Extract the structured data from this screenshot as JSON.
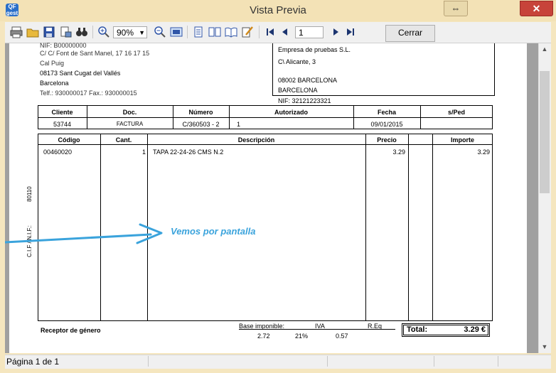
{
  "window": {
    "title": "Vista Previa",
    "app_icon_text": "QF\ngest",
    "restore_glyph": "⇔",
    "close_glyph": "✕"
  },
  "toolbar": {
    "zoom_value": "90%",
    "page_value": "1",
    "close_label": "Cerrar"
  },
  "status": {
    "page_text": "Página 1 de 1"
  },
  "sender": {
    "nif": "NIF: B00000000",
    "addr1": "C/ C/ Font de Sant Manel, 17 16 17 15",
    "addr2": "Cal Puig",
    "city": "08173 Sant Cugat del Vallés",
    "province": "Barcelona",
    "phones": "Telf.: 930000017 Fax.: 930000015"
  },
  "recipient": {
    "name": "Empresa de pruebas S.L.",
    "street": "C\\ Alicante, 3",
    "zip_city": "08002 BARCELONA",
    "province": "BARCELONA",
    "nif": "NIF: 32121223321"
  },
  "header_table": {
    "labels": {
      "cliente": "Cliente",
      "doc": "Doc.",
      "numero": "Número",
      "autorizado": "Autorizado",
      "fecha": "Fecha",
      "sped": "s/Ped"
    },
    "values": {
      "cliente": "53744",
      "doc": "FACTURA",
      "numero": "C/360503 - 2",
      "autorizado": "1",
      "fecha": "09/01/2015",
      "sped": ""
    }
  },
  "lines_table": {
    "headers": {
      "codigo": "Código",
      "cant": "Cant.",
      "descripcion": "Descripción",
      "precio": "Precio",
      "importe": "Importe"
    },
    "rows": [
      {
        "codigo": "00460020",
        "cant": "1",
        "descripcion": "TAPA 22-24-26 CMS N.2",
        "precio": "3.29",
        "importe": "3.29"
      }
    ]
  },
  "side_text": {
    "cif": "C.I.F / N.I.F.:",
    "num": "80110"
  },
  "annotation": "Vemos por pantalla",
  "footer": {
    "receptor": "Receptor de género",
    "base_label": "Base imponible:",
    "iva_label": "IVA",
    "req_label": "R.Eq",
    "base_value": "2.72",
    "iva_pct": "21%",
    "iva_value": "0.57",
    "total_label": "Total:",
    "total_value": "3.29 €"
  },
  "colors": {
    "accent_annotation": "#3aa3dc",
    "title_bar": "#f3e2b6",
    "close_button": "#c7433a"
  }
}
